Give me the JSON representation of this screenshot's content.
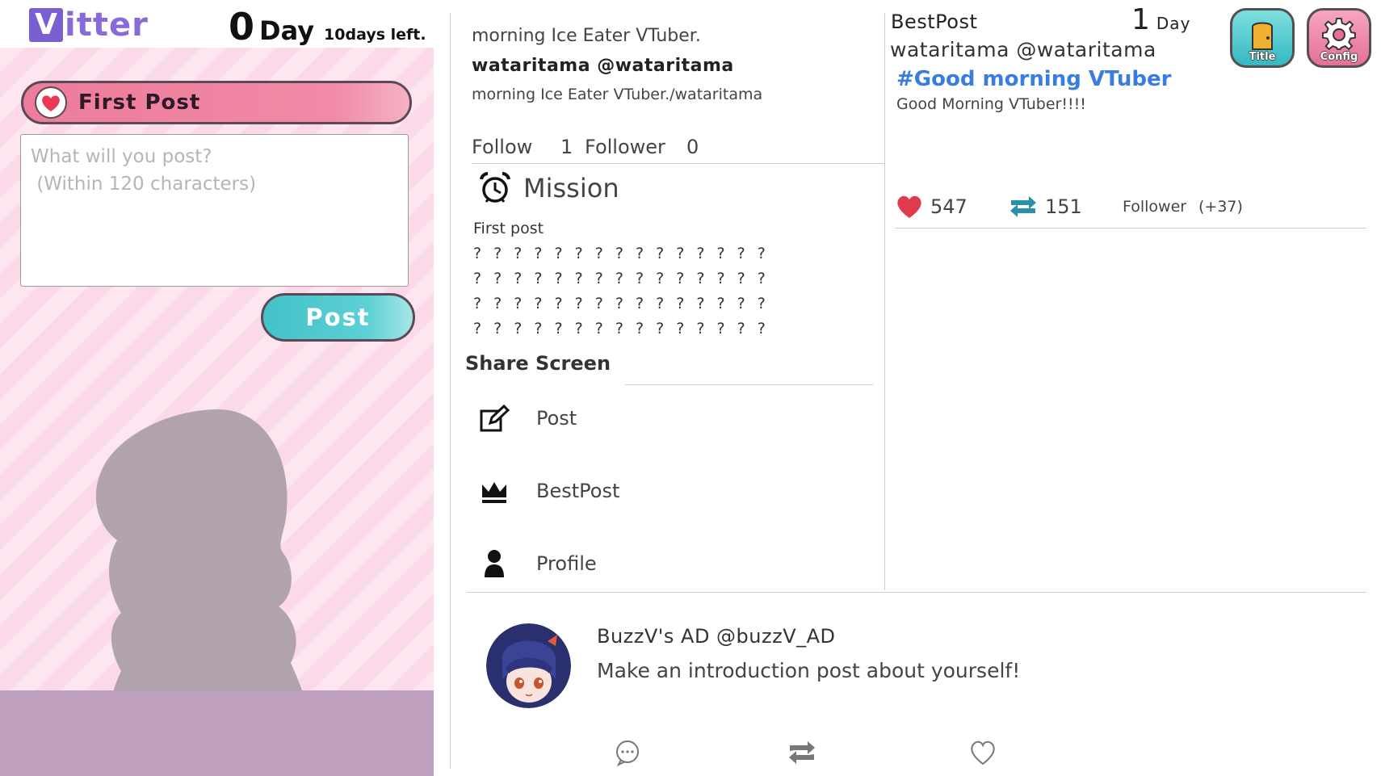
{
  "app": {
    "logo_letter": "V",
    "logo_rest": "itter",
    "day_number": "0",
    "day_word": "Day",
    "days_left": "10days left."
  },
  "compose": {
    "mission_label": "First Post",
    "placeholder": "What will you post?\n (Within 120 characters)",
    "value": "",
    "post_button": "Post"
  },
  "profile": {
    "bio_top": "morning Ice Eater VTuber.",
    "name_handle": "wataritama @wataritama",
    "bio": "morning Ice Eater VTuber./wataritama",
    "follow_label": "Follow",
    "follow_count": "1",
    "follower_label": "Follower",
    "follower_count": "0"
  },
  "mission": {
    "title": "Mission",
    "items": [
      "First post",
      "? ? ? ? ? ? ? ? ? ? ? ? ? ? ?",
      "? ? ? ? ? ? ? ? ? ? ? ? ? ? ?",
      "? ? ? ? ? ? ? ? ? ? ? ? ? ? ?",
      "? ? ? ? ? ? ? ? ? ? ? ? ? ? ?"
    ]
  },
  "share": {
    "heading": "Share Screen",
    "items": [
      {
        "label": "Post",
        "icon": "edit-icon"
      },
      {
        "label": "BestPost",
        "icon": "crown-icon"
      },
      {
        "label": "Profile",
        "icon": "person-icon"
      }
    ]
  },
  "best_post": {
    "title": "BestPost",
    "day_number": "1",
    "day_word": "Day",
    "author": "wataritama @wataritama",
    "hashtag": "#Good morning VTuber",
    "text": "Good Morning VTuber!!!!",
    "likes": "547",
    "reposts": "151",
    "follower_label": "Follower",
    "follower_gain": "(+37)"
  },
  "top_buttons": {
    "title": "Title",
    "config": "Config"
  },
  "ad": {
    "name": "BuzzV's AD @buzzV_AD",
    "text": "Make an introduction post about yourself!"
  },
  "colors": {
    "accent_purple": "#7a5fd0",
    "banner_pink": "#ee7c9b",
    "post_teal": "#43c2c8",
    "hashtag_blue": "#3a7de0",
    "like_red": "#e03a4d",
    "repost_teal": "#2a8fa8"
  }
}
